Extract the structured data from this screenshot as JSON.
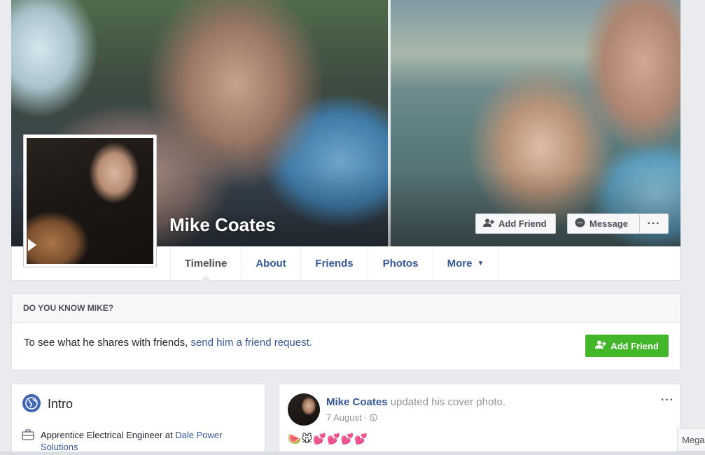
{
  "profile": {
    "name": "Mike Coates"
  },
  "cover_actions": {
    "add_friend": "Add Friend",
    "message": "Message",
    "more": "···"
  },
  "nav": {
    "tabs": [
      {
        "label": "Timeline",
        "active": true
      },
      {
        "label": "About"
      },
      {
        "label": "Friends"
      },
      {
        "label": "Photos"
      },
      {
        "label": "More"
      }
    ],
    "more_caret": "▼"
  },
  "know": {
    "header": "DO YOU KNOW MIKE?",
    "text": "To see what he shares with friends, ",
    "link": "send him a friend request.",
    "button": "Add Friend"
  },
  "intro": {
    "title": "Intro",
    "work_prefix": "Apprentice Electrical Engineer at ",
    "work_link": "Dale Power Solutions"
  },
  "post": {
    "author": "Mike Coates",
    "action": " updated his cover photo.",
    "date": "7 August · ",
    "menu": "···",
    "emoji": "🍉🐭💕💕💕💕"
  },
  "chat": {
    "label": "Mega"
  },
  "colors": {
    "link": "#365899",
    "green": "#42b72a",
    "background": "#e9ebee"
  },
  "icons": [
    "add-friend-icon",
    "messenger-icon",
    "globe-icon",
    "briefcase-icon",
    "privacy-globe-icon",
    "dropdown-caret-icon"
  ]
}
